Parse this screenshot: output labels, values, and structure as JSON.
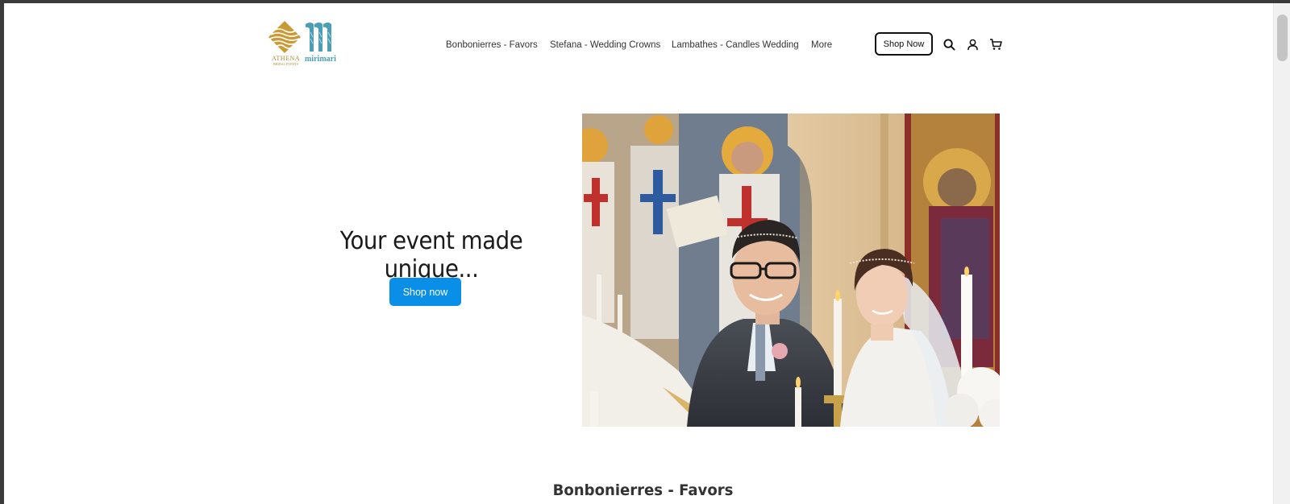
{
  "header": {
    "logo": {
      "athena_text": "ATHENA",
      "athena_sub": "BRIDAL EVENTS",
      "mirimari_text": "mirimari"
    },
    "nav": [
      {
        "label": "Bonbonierres - Favors"
      },
      {
        "label": "Stefana - Wedding Crowns"
      },
      {
        "label": "Lambathes - Candles Wedding"
      },
      {
        "label": "More"
      }
    ],
    "shop_now_label": "Shop Now",
    "icons": [
      "search-icon",
      "account-icon",
      "cart-icon"
    ]
  },
  "hero": {
    "title": "Your event made unique...",
    "button_label": "Shop now",
    "accent_color": "#0a8fe8"
  },
  "section": {
    "title": "Bonbonierres - Favors"
  }
}
